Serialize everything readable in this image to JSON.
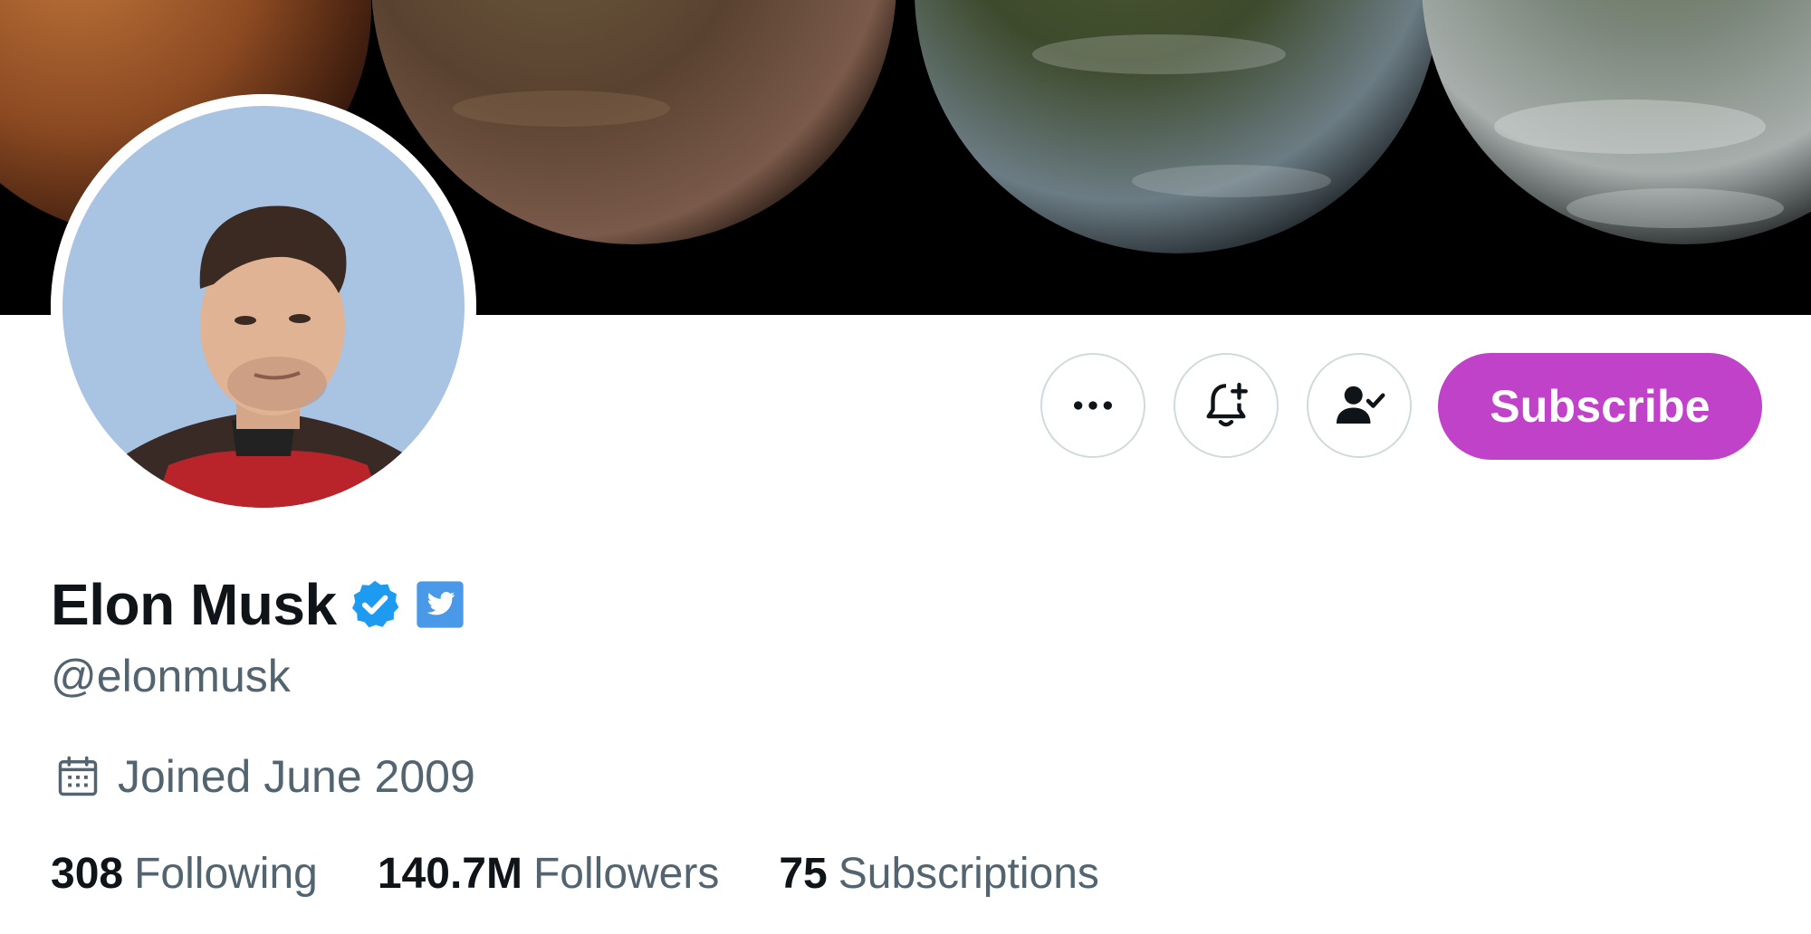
{
  "profile": {
    "display_name": "Elon Musk",
    "handle": "@elonmusk",
    "joined": "Joined June 2009",
    "verified_badge_icon": "verified-check-icon",
    "affiliate_badge_icon": "twitter-bird-icon"
  },
  "actions": {
    "more_icon": "more-horizontal-icon",
    "notify_icon": "bell-plus-icon",
    "following_icon": "person-check-icon",
    "subscribe_label": "Subscribe"
  },
  "stats": [
    {
      "value": "308",
      "label": "Following"
    },
    {
      "value": "140.7M",
      "label": "Followers"
    },
    {
      "value": "75",
      "label": "Subscriptions"
    }
  ],
  "colors": {
    "subscribe_bg": "#c042c9",
    "verified_blue": "#1d9bf0",
    "text_primary": "#0f1419",
    "text_secondary": "#536471",
    "border": "#cfd9de"
  }
}
